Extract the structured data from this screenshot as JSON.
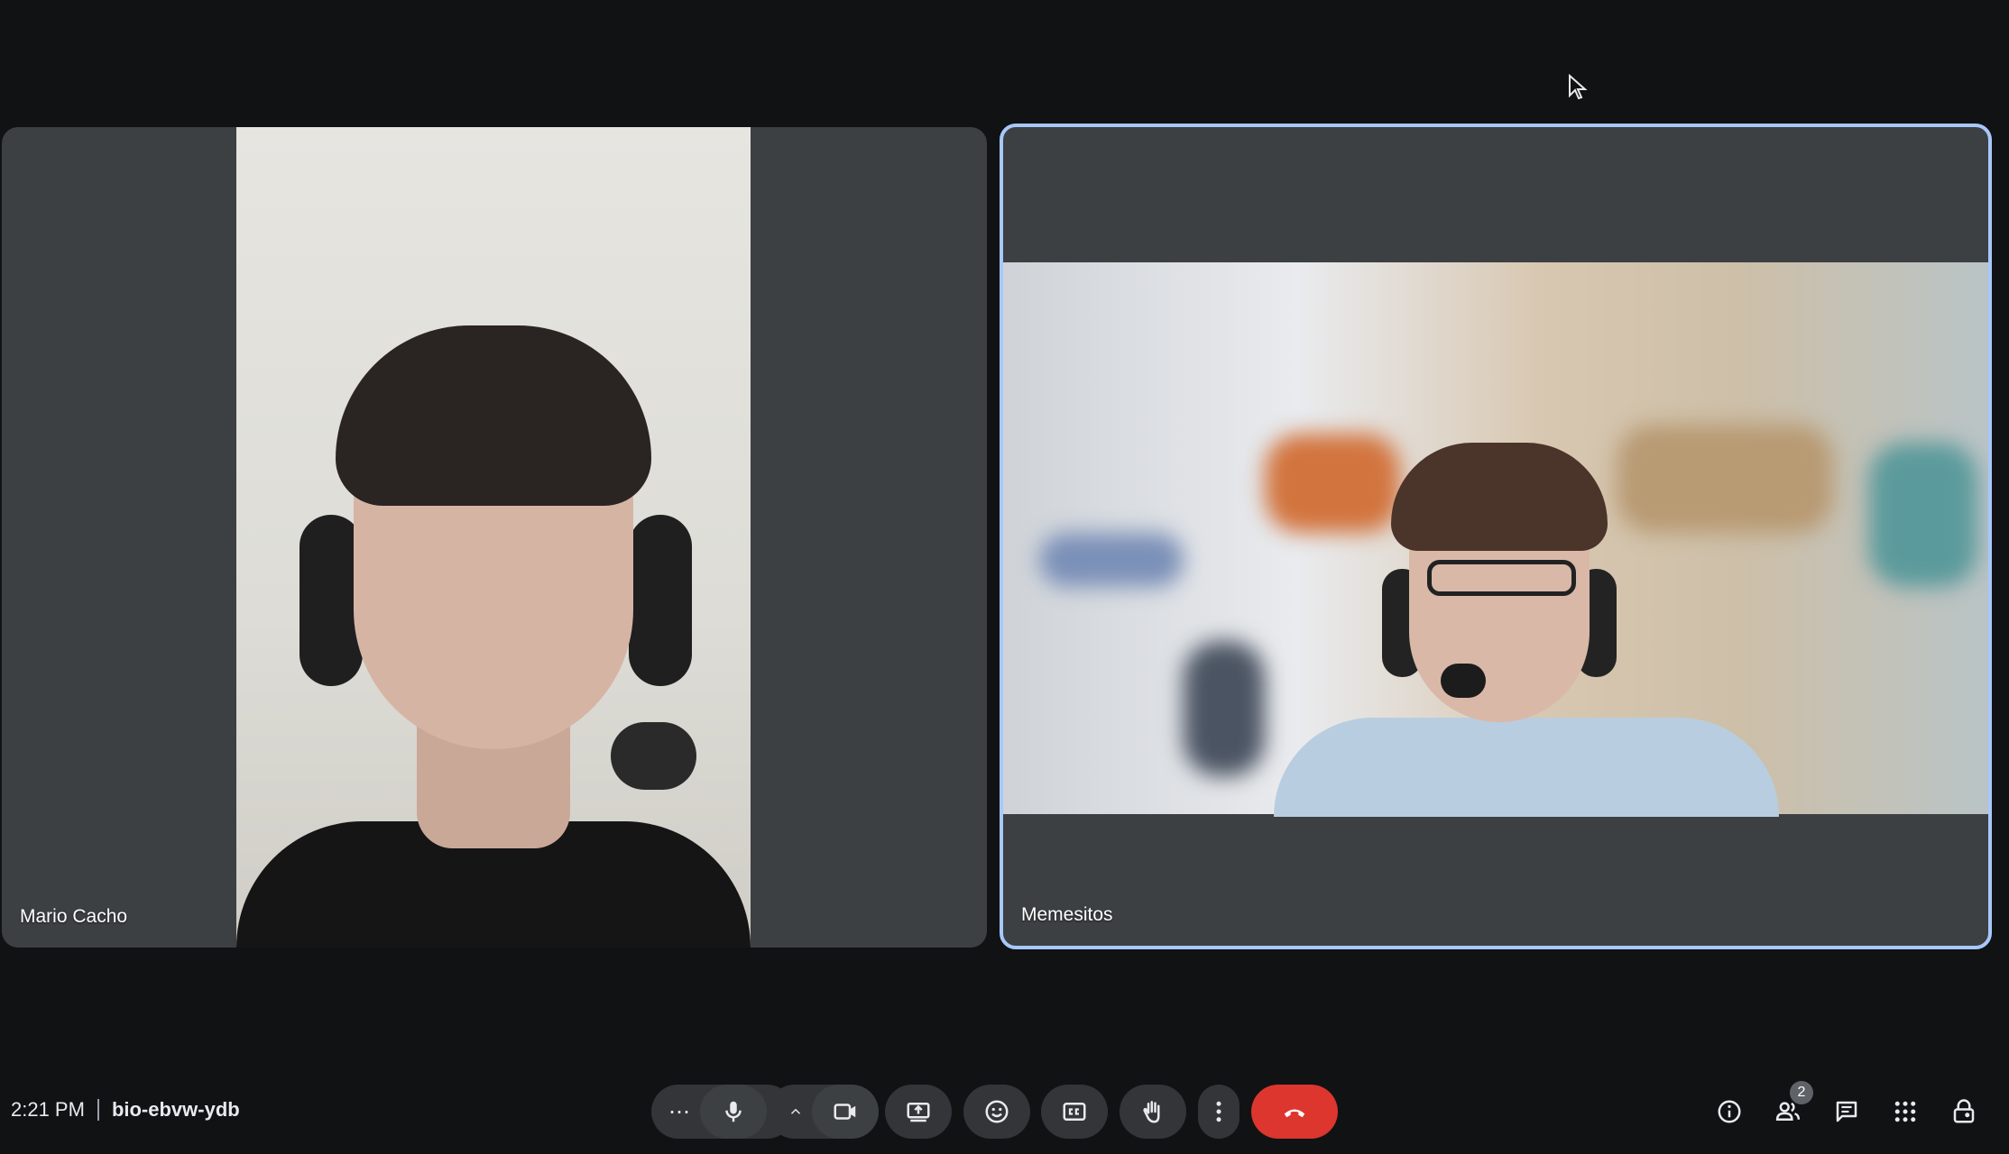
{
  "participants": [
    {
      "name": "Mario Cacho"
    },
    {
      "name": "Memesitos"
    }
  ],
  "meeting": {
    "time": "2:21 PM",
    "code": "bio-ebvw-ydb"
  },
  "controls": {
    "more_options_label": "⋯",
    "people_count": "2"
  },
  "colors": {
    "background": "#111214",
    "tile": "#3c4043",
    "active_speaker_border": "#a8c7fa",
    "end_call": "#dc362e"
  }
}
